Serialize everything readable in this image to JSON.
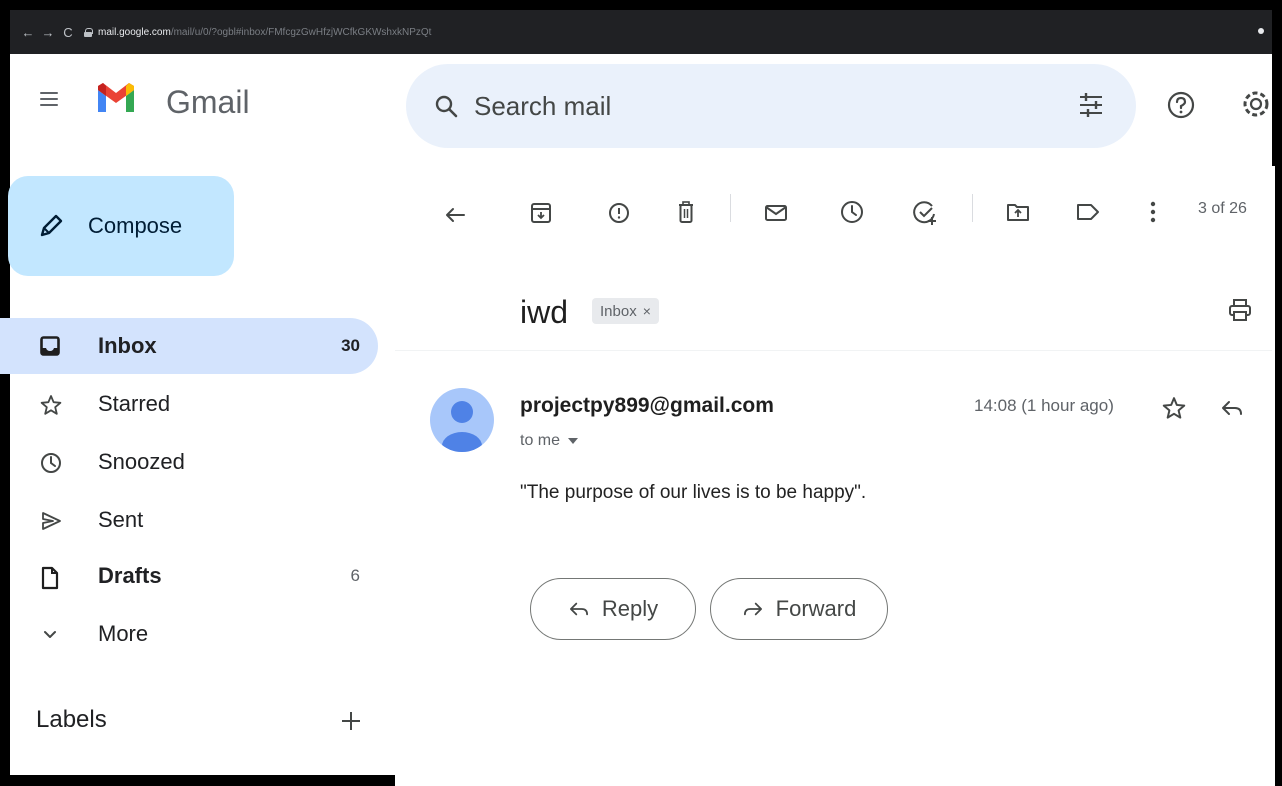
{
  "browser": {
    "url_host": "mail.google.com",
    "url_path": "/mail/u/0/?ogbl#inbox/FMfcgzGwHfzjWCfkGKWshxkNPzQt"
  },
  "header": {
    "app_name": "Gmail",
    "search_placeholder": "Search mail"
  },
  "sidebar": {
    "compose_label": "Compose",
    "items": [
      {
        "label": "Inbox",
        "count": "30",
        "icon": "inbox-icon",
        "active": true
      },
      {
        "label": "Starred",
        "count": "",
        "icon": "star-icon"
      },
      {
        "label": "Snoozed",
        "count": "",
        "icon": "clock-icon"
      },
      {
        "label": "Sent",
        "count": "",
        "icon": "send-icon"
      },
      {
        "label": "Drafts",
        "count": "6",
        "icon": "file-icon"
      },
      {
        "label": "More",
        "count": "",
        "icon": "chevron-down-icon"
      }
    ],
    "labels_heading": "Labels"
  },
  "toolbar": {
    "pager": "3 of 26"
  },
  "message": {
    "subject": "iwd",
    "chip_label": "Inbox",
    "chip_close": "×",
    "sender": "projectpy899@gmail.com",
    "to_me": "to me",
    "timestamp": "14:08 (1 hour ago)",
    "body": "\"The purpose of our lives is to be happy\".",
    "reply_label": "Reply",
    "forward_label": "Forward"
  },
  "colors": {
    "compose_bg": "#c2e7ff",
    "active_nav_bg": "#d3e3fd",
    "search_bg": "#eaf1fb",
    "avatar_bg": "#a8c7fa",
    "avatar_fg": "#4f82e6"
  }
}
